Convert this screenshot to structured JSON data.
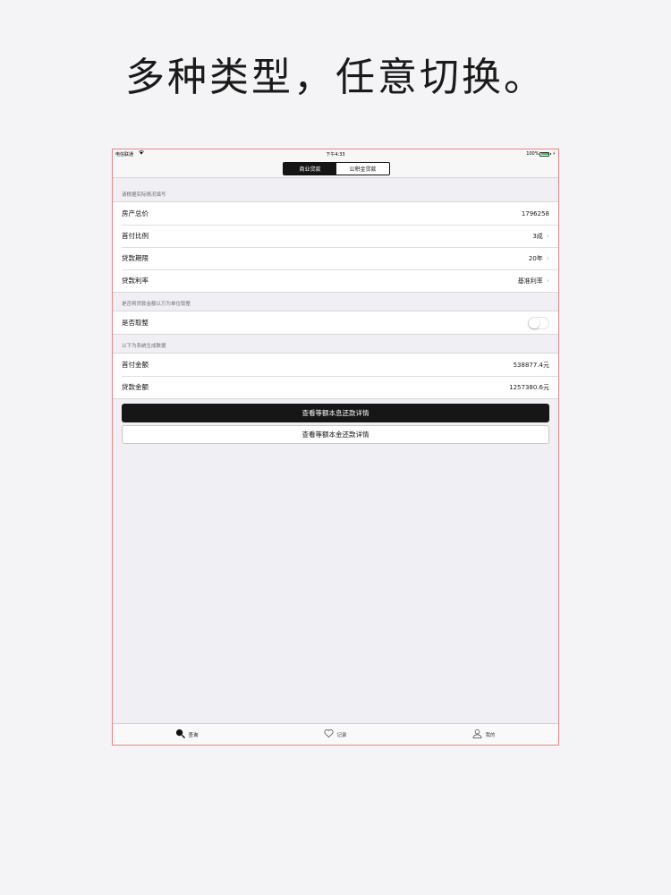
{
  "headline": "多种类型，任意切换。",
  "status_bar": {
    "carrier": "电信联通",
    "wifi_icon": "wifi-icon",
    "time": "下午4:33",
    "battery": "100%"
  },
  "segmented_control": {
    "tabs": [
      "商业贷款",
      "公积金贷款"
    ],
    "selected_index": 0
  },
  "sections": [
    {
      "header": "请根据实际情况填写",
      "rows": [
        {
          "label": "房产总价",
          "value": "1796258",
          "disclosure": false
        },
        {
          "label": "首付比例",
          "value": "3成",
          "disclosure": true
        },
        {
          "label": "贷款期限",
          "value": "20年",
          "disclosure": true
        },
        {
          "label": "贷款利率",
          "value": "基准利率",
          "disclosure": true
        }
      ]
    },
    {
      "header": "是否将贷款金额以万为单位取整",
      "rows": [
        {
          "label": "是否取整",
          "toggle": false
        }
      ]
    },
    {
      "header": "以下为系统生成数据",
      "rows": [
        {
          "label": "首付金额",
          "value": "538877.4元"
        },
        {
          "label": "贷款金额",
          "value": "1257380.6元"
        }
      ]
    }
  ],
  "buttons": {
    "equal_interest": "查看等额本息还款详情",
    "equal_principal": "查看等额本金还款详情"
  },
  "tab_bar": [
    {
      "label": "查询",
      "icon": "search-icon",
      "active": true
    },
    {
      "label": "记录",
      "icon": "heart-icon",
      "active": false
    },
    {
      "label": "我的",
      "icon": "person-icon",
      "active": false
    }
  ],
  "colors": {
    "primary": "#161616",
    "background": "#efeff4",
    "frame_border": "#e8868a"
  }
}
